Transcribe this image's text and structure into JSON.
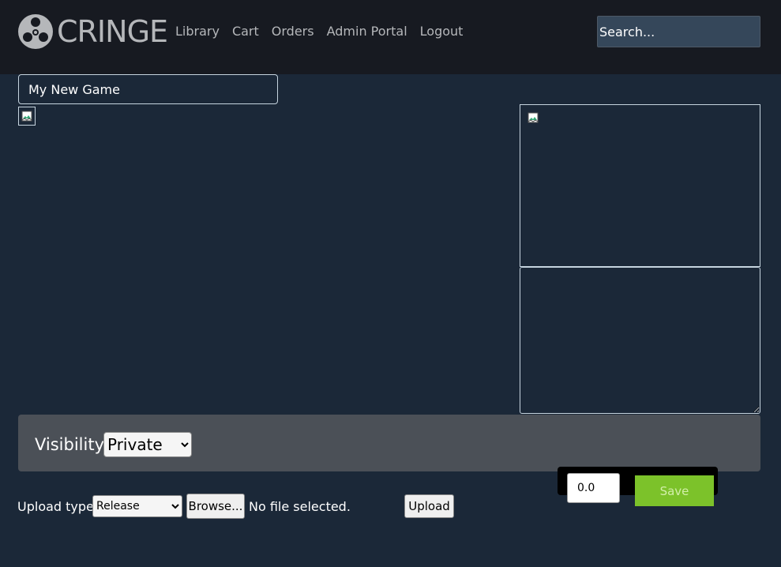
{
  "header": {
    "logo_text": "CRINGE",
    "nav": [
      "Library",
      "Cart",
      "Orders",
      "Admin Portal",
      "Logout"
    ],
    "search_placeholder": "Search..."
  },
  "editor": {
    "game_title": "My New Game",
    "description_value": ""
  },
  "visibility": {
    "label": "Visibility:",
    "selected": "Private"
  },
  "pricing": {
    "price_value": "0.0",
    "save_label": "Save"
  },
  "upload": {
    "type_label": "Upload type:",
    "type_selected": "Release",
    "browse_label": "Browse...",
    "file_status": "No file selected.",
    "upload_label": "Upload"
  },
  "icons": {
    "logo": "fidget-spinner-icon",
    "broken_image": "broken-image-icon"
  }
}
